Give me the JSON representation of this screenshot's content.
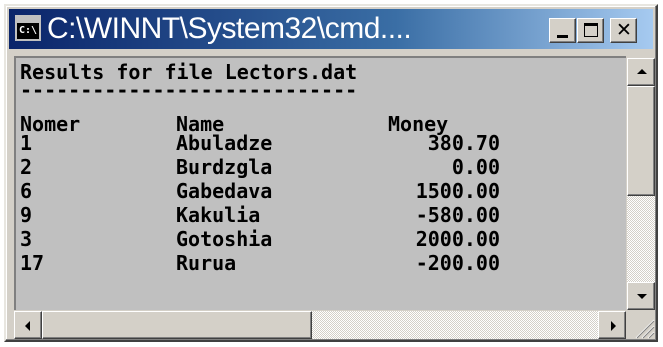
{
  "window": {
    "title": "C:\\WINNT\\System32\\cmd....",
    "icon_text": "C:\\"
  },
  "console": {
    "header_line": "Results for file Lectors.dat",
    "separator_line": "----------------------------",
    "columns": {
      "nomer": "Nomer",
      "name": "Name",
      "money": "Money"
    },
    "rows": [
      {
        "nomer": "1",
        "name": "Abuladze",
        "money": "380.70"
      },
      {
        "nomer": "2",
        "name": "Burdzgla",
        "money": "0.00"
      },
      {
        "nomer": "6",
        "name": "Gabedava",
        "money": "1500.00"
      },
      {
        "nomer": "9",
        "name": "Kakulia",
        "money": "-580.00"
      },
      {
        "nomer": "3",
        "name": "Gotoshia",
        "money": "2000.00"
      },
      {
        "nomer": "17",
        "name": "Rurua",
        "money": "-200.00"
      }
    ]
  },
  "colors": {
    "console_bg": "#c0c0c0",
    "console_text": "#000000",
    "title_active_start": "#0a246a",
    "title_active_end": "#a6caf0",
    "chrome": "#d4d0c8"
  },
  "icons": {
    "window_icon": "cmd-console-icon",
    "minimize": "minimize-icon",
    "maximize": "maximize-icon",
    "close": "close-icon",
    "scroll_up": "arrow-up-icon",
    "scroll_down": "arrow-down-icon",
    "scroll_left": "arrow-left-icon",
    "scroll_right": "arrow-right-icon",
    "resize": "resize-grip-icon"
  }
}
